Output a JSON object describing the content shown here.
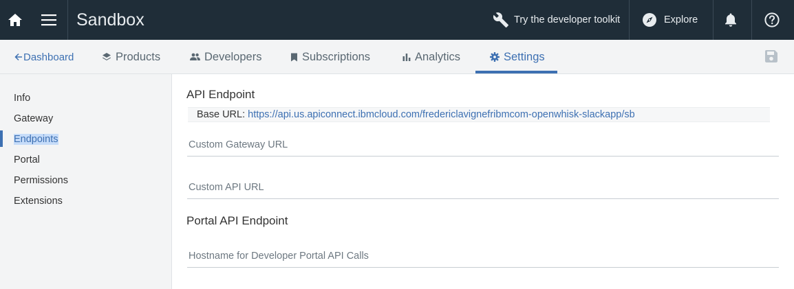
{
  "header": {
    "title": "Sandbox",
    "toolkit_label": "Try the developer toolkit",
    "explore_label": "Explore"
  },
  "nav": {
    "back_label": "Dashboard",
    "tabs": [
      {
        "label": "Products",
        "icon": "layers-icon"
      },
      {
        "label": "Developers",
        "icon": "people-icon"
      },
      {
        "label": "Subscriptions",
        "icon": "bookmark-icon"
      },
      {
        "label": "Analytics",
        "icon": "bar-chart-icon"
      },
      {
        "label": "Settings",
        "icon": "gear-icon",
        "active": true
      }
    ]
  },
  "sidebar": {
    "items": [
      {
        "label": "Info"
      },
      {
        "label": "Gateway"
      },
      {
        "label": "Endpoints",
        "active": true
      },
      {
        "label": "Portal"
      },
      {
        "label": "Permissions"
      },
      {
        "label": "Extensions"
      }
    ]
  },
  "main": {
    "api_endpoint_title": "API Endpoint",
    "base_url_label": "Base URL:",
    "base_url_value": "https://api.us.apiconnect.ibmcloud.com/fredericlavignefribmcom-openwhisk-slackapp/sb",
    "custom_gateway_placeholder": "Custom Gateway URL",
    "custom_api_placeholder": "Custom API URL",
    "portal_title": "Portal API Endpoint",
    "hostname_placeholder": "Hostname for Developer Portal API Calls"
  },
  "colors": {
    "topbar": "#1f2d38",
    "accent": "#3d70b2",
    "nav_bg": "#f3f4f5"
  }
}
